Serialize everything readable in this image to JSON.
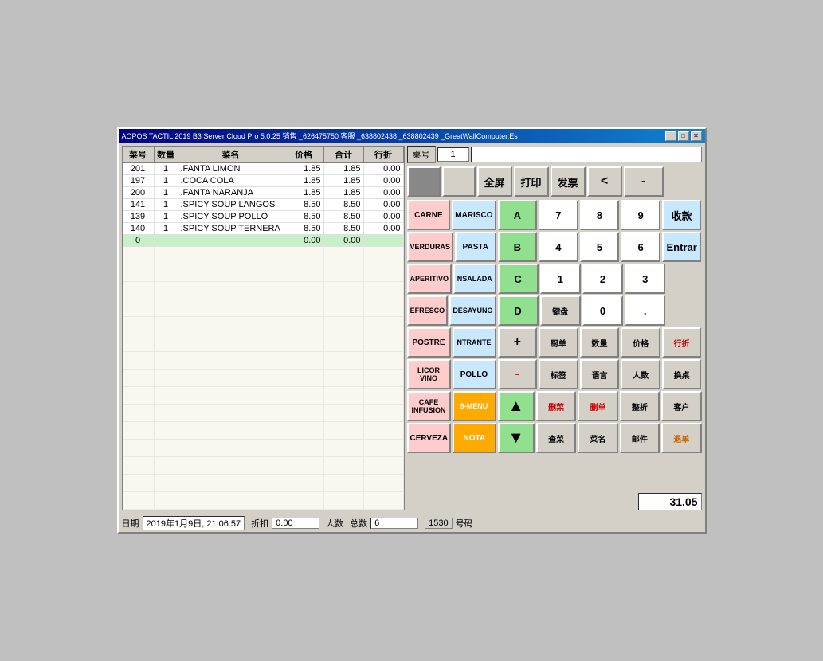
{
  "window": {
    "title": "AOPOS TACTIL 2019 B3 Server Cloud Pro 5.0.25 销售 _626475750 客服 _638802438 _638802439 _GreatWallComputer.Es",
    "min_btn": "_",
    "max_btn": "□",
    "close_btn": "✕"
  },
  "table": {
    "headers": [
      "菜号",
      "数量",
      "菜名",
      "价格",
      "合计",
      "行折"
    ],
    "rows": [
      {
        "id": "201",
        "qty": "1",
        "name": ".FANTA LIMON",
        "price": "1.85",
        "total": "1.85",
        "disc": "0.00"
      },
      {
        "id": "197",
        "qty": "1",
        "name": ".COCA COLA",
        "price": "1.85",
        "total": "1.85",
        "disc": "0.00"
      },
      {
        "id": "200",
        "qty": "1",
        "name": ".FANTA NARANJA",
        "price": "1.85",
        "total": "1.85",
        "disc": "0.00"
      },
      {
        "id": "141",
        "qty": "1",
        "name": ".SPICY SOUP LANGOS",
        "price": "8.50",
        "total": "8.50",
        "disc": "0.00"
      },
      {
        "id": "139",
        "qty": "1",
        "name": ".SPICY SOUP POLLO",
        "price": "8.50",
        "total": "8.50",
        "disc": "0.00"
      },
      {
        "id": "140",
        "qty": "1",
        "name": ".SPICY SOUP TERNERA",
        "price": "8.50",
        "total": "8.50",
        "disc": "0.00"
      },
      {
        "id": "0",
        "qty": "",
        "name": "",
        "price": "0.00",
        "total": "0.00",
        "disc": ""
      }
    ]
  },
  "order": {
    "label": "桌号",
    "number": "1",
    "amount": "31.05"
  },
  "categories": [
    {
      "label": "CARNE",
      "color": "pink"
    },
    {
      "label": "MARISCO",
      "color": "lightblue"
    },
    {
      "label": "VERDURAS",
      "color": "pink"
    },
    {
      "label": "PASTA",
      "color": "lightblue"
    },
    {
      "label": "APERITIVO",
      "color": "pink"
    },
    {
      "label": "NSALADA",
      "color": "lightblue"
    },
    {
      "label": "EFRESCO",
      "color": "pink"
    },
    {
      "label": "DESAYUNO",
      "color": "lightblue"
    },
    {
      "label": "POSTRE",
      "color": "pink"
    },
    {
      "label": "NTRANTE",
      "color": "lightblue"
    },
    {
      "label": "LICOR VINO",
      "color": "pink"
    },
    {
      "label": "POLLO",
      "color": "lightblue"
    },
    {
      "label": "CAFE INFUSION",
      "color": "pink"
    },
    {
      "label": "9-MENU",
      "color": "orange"
    },
    {
      "label": "CERVEZA",
      "color": "pink"
    },
    {
      "label": "NOTA",
      "color": "orange"
    }
  ],
  "numpad": {
    "keys": [
      "A",
      "7",
      "8",
      "9",
      "B",
      "4",
      "5",
      "6",
      "C",
      "1",
      "2",
      "3",
      "D",
      "键盘",
      "0",
      "."
    ],
    "special": [
      "全屏",
      "打印",
      "发票",
      "<",
      "-",
      "收款",
      "Entrar"
    ]
  },
  "action_buttons": {
    "row1": [
      "+",
      "厨单",
      "数量",
      "价格",
      "行折"
    ],
    "row2": [
      "-",
      "标签",
      "语言",
      "人数",
      "换桌"
    ],
    "row3": [
      "▲",
      "删菜",
      "删单",
      "整折",
      "客户"
    ],
    "row4": [
      "▼",
      "查菜",
      "菜名",
      "邮件",
      "退单"
    ]
  },
  "status_bar": {
    "date_label": "日期",
    "date_value": "2019年1月9日, 21:06:57",
    "disc_label": "折扣",
    "disc_value": "0.00",
    "people_label": "人数",
    "total_label": "总数",
    "total_value": "6",
    "code_label": "号码",
    "code_value": "1530"
  }
}
